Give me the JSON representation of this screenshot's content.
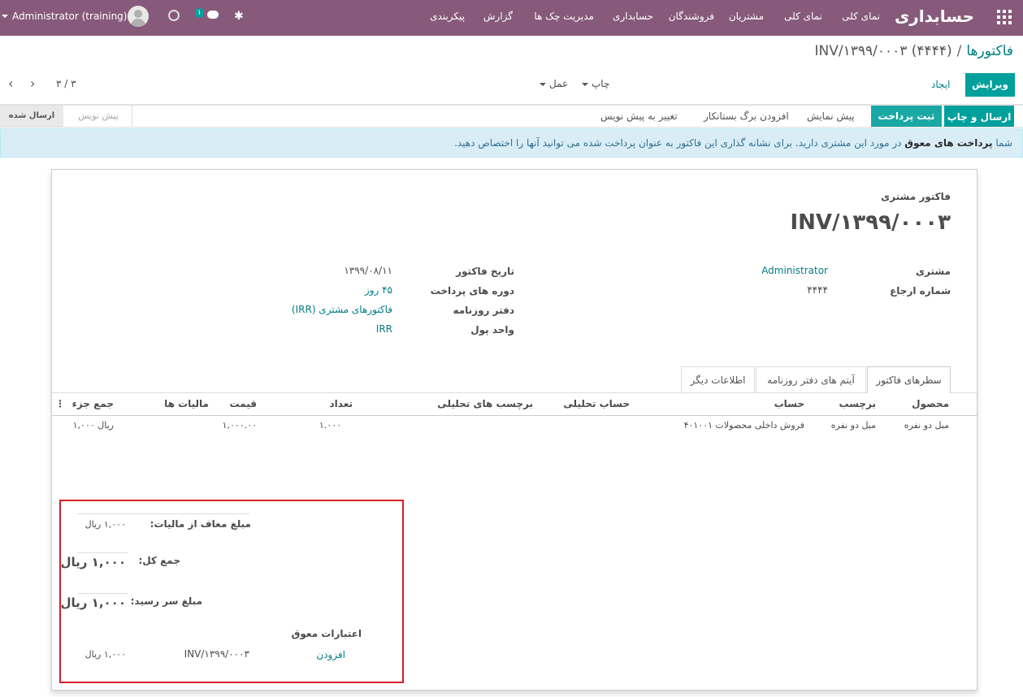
{
  "navbar": {
    "brand": "حسابداری",
    "menu": [
      "نمای کلی",
      "نمای کلی",
      "مشتریان",
      "فروشندگان",
      "حسابداری",
      "مدیریت چک ها",
      "گزارش",
      "پیکربندی"
    ],
    "user": "Administrator (training)",
    "chat_badge": "۱"
  },
  "breadcrumb": {
    "parent": "فاکتورها",
    "separator": "/",
    "current": "INV/۱۳۹۹/۰۰۰۳ (۴۴۴۴)"
  },
  "controls": {
    "edit": "ویرایش",
    "create": "ایجاد",
    "print": "چاپ",
    "action": "عمل",
    "pager": "۳ / ۳"
  },
  "statusbar": {
    "send_print": "ارسال و چاپ",
    "register_payment": "ثبت پرداخت",
    "preview": "پیش نمایش",
    "add_credit_note": "افزودن برگ بستانکار",
    "reset_to_draft": "تغییر به پیش نویس",
    "states": [
      "پیش نویس",
      "ارسال شده"
    ]
  },
  "alert": {
    "prefix": "شما",
    "bold": "پرداخت های معوق",
    "rest": "در مورد این مشتری دارید. برای نشانه گذاری این فاکتور به عنوان پرداخت شده می توانید آنها را اختصاص دهید."
  },
  "invoice": {
    "type_label": "فاکتور مشتری",
    "number": "INV/۱۳۹۹/۰۰۰۳",
    "fields_right": [
      {
        "label": "مشتری",
        "value": "Administrator",
        "link": true
      },
      {
        "label": "شماره ارجاع",
        "value": "۴۴۴۴",
        "link": false
      }
    ],
    "fields_left": [
      {
        "label": "تاریخ فاکتور",
        "value": "۱۳۹۹/۰۸/۱۱",
        "link": false
      },
      {
        "label": "دوره های پرداخت",
        "value": "۴۵ روز",
        "link": true
      },
      {
        "label": "دفتر روزنامه",
        "value": "فاکتورهای مشتری (IRR)",
        "link": true
      },
      {
        "label": "واحد پول",
        "value": "IRR",
        "link": true
      }
    ]
  },
  "tabs": [
    "سطرهای فاکتور",
    "آیتم های دفتر روزنامه",
    "اطلاعات دیگر"
  ],
  "table": {
    "headers": [
      "محصول",
      "برچسب",
      "حساب",
      "حساب تحلیلی",
      "برچسب های تحلیلی",
      "تعداد",
      "قیمت",
      "مالیات ها",
      "جمع جزء"
    ],
    "row": [
      "مبل دو نفره",
      "مبل دو نفره",
      "۴۰۱۰۰۱ فروش داخلی محصولات",
      "",
      "",
      "۱.۰۰۰",
      "۱,۰۰۰.۰۰",
      "",
      "۱,۰۰۰ ریال"
    ]
  },
  "totals": {
    "untaxed_label": "مبلغ معاف از مالیات:",
    "untaxed_value": "۱,۰۰۰ ریال",
    "total_label": "جمع کل:",
    "total_value": "۱,۰۰۰ ریال",
    "due_label": "مبلغ سر رسید:",
    "due_value": "۱,۰۰۰ ریال",
    "outstanding_title": "اعتبارات معوق",
    "outstanding_add": "افزودن",
    "outstanding_ref": "INV/۱۳۹۹/۰۰۰۳",
    "outstanding_amount": "۱,۰۰۰ ریال"
  },
  "colors": {
    "navbar": "#875a7b",
    "primary": "#00a09d",
    "link": "#017e84",
    "alert_bg": "#d9edf7",
    "highlight_border": "#d42027"
  }
}
